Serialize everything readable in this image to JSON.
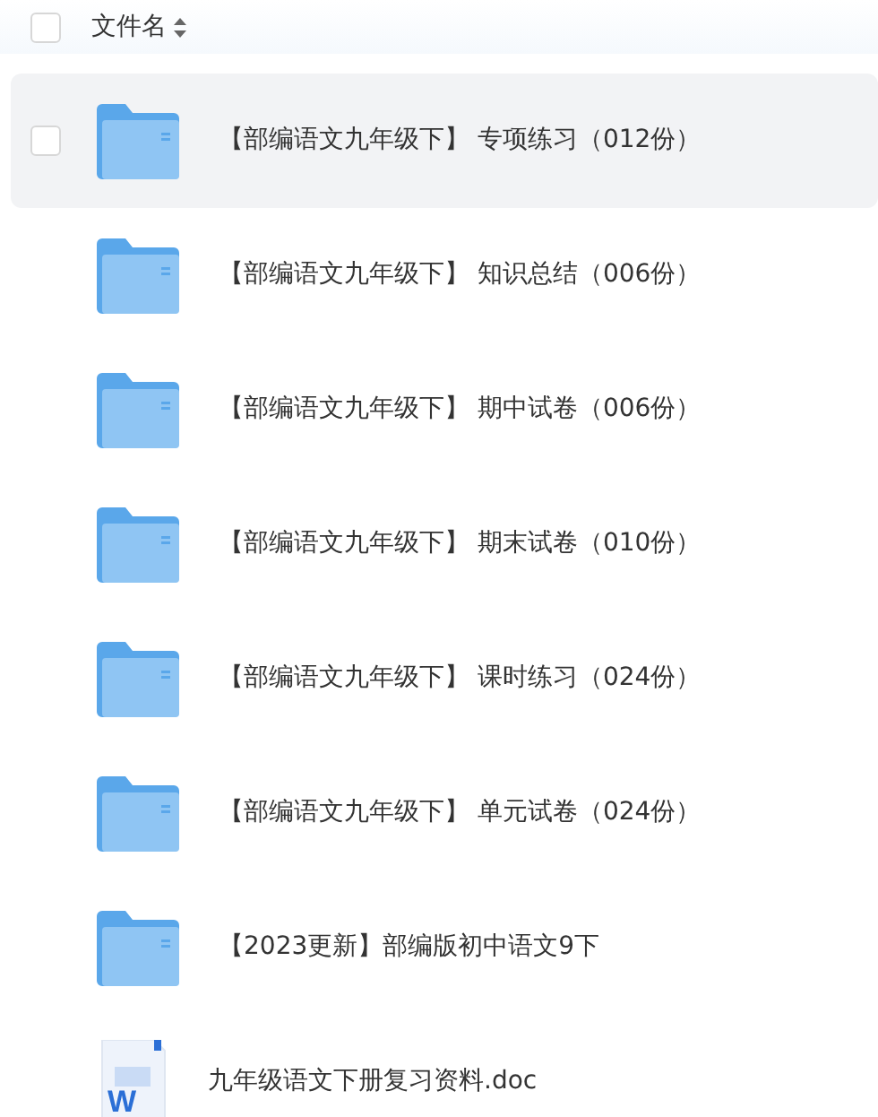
{
  "header": {
    "checked": false,
    "column_label": "文件名"
  },
  "files": [
    {
      "kind": "folder",
      "name": "【部编语文九年级下】 专项练习（012份）",
      "hovered": true,
      "checked": false
    },
    {
      "kind": "folder",
      "name": "【部编语文九年级下】 知识总结（006份）",
      "hovered": false,
      "checked": false
    },
    {
      "kind": "folder",
      "name": "【部编语文九年级下】 期中试卷（006份）",
      "hovered": false,
      "checked": false
    },
    {
      "kind": "folder",
      "name": "【部编语文九年级下】 期末试卷（010份）",
      "hovered": false,
      "checked": false
    },
    {
      "kind": "folder",
      "name": "【部编语文九年级下】 课时练习（024份）",
      "hovered": false,
      "checked": false
    },
    {
      "kind": "folder",
      "name": "【部编语文九年级下】 单元试卷（024份）",
      "hovered": false,
      "checked": false
    },
    {
      "kind": "folder",
      "name": "【2023更新】部编版初中语文9下",
      "hovered": false,
      "checked": false
    },
    {
      "kind": "doc",
      "name": "九年级语文下册复习资料.doc",
      "hovered": false,
      "checked": false,
      "icon_text": "W"
    }
  ]
}
